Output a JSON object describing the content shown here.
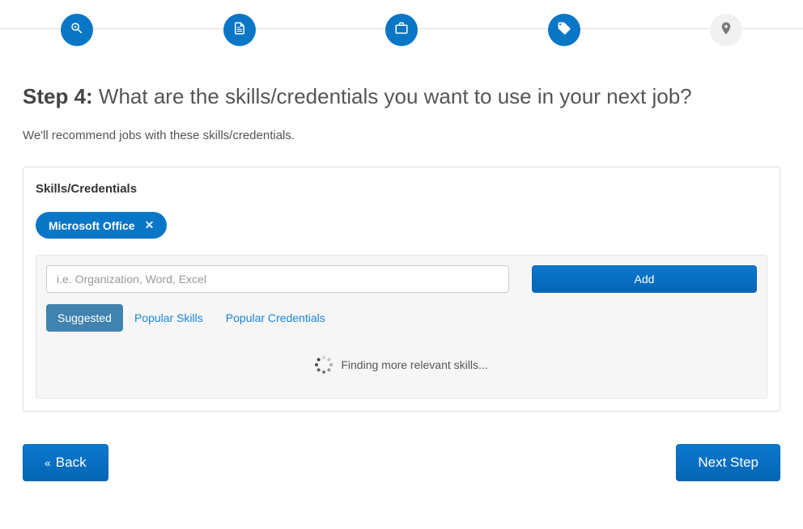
{
  "heading": {
    "prefix": "Step 4:",
    "text": "What are the skills/credentials you want to use in your next job?"
  },
  "subheading": "We'll recommend jobs with these skills/credentials.",
  "card": {
    "title": "Skills/Credentials",
    "selected_skills": [
      {
        "label": "Microsoft Office"
      }
    ],
    "input_placeholder": "i.e. Organization, Word, Excel",
    "add_button": "Add",
    "tabs": {
      "suggested": "Suggested",
      "popular_skills": "Popular Skills",
      "popular_credentials": "Popular Credentials"
    },
    "loading_text": "Finding more relevant skills..."
  },
  "footer": {
    "back": "Back",
    "next": "Next Step"
  }
}
